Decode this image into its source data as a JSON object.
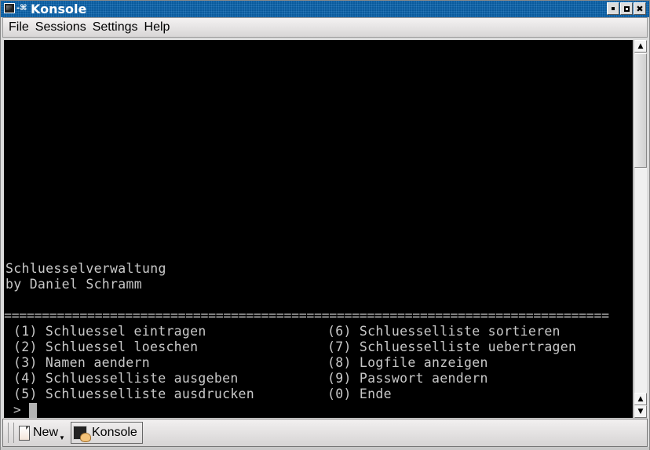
{
  "window": {
    "title": "Konsole",
    "controls": {
      "minimize": "minimize",
      "maximize": "maximize",
      "close": "✖"
    }
  },
  "menubar": {
    "items": [
      "File",
      "Sessions",
      "Settings",
      "Help"
    ]
  },
  "terminal": {
    "header_line1": "Schluesselverwaltung",
    "header_line2": "by Daniel Schramm",
    "separator": "================================================================================",
    "menu_left": [
      "(1) Schluessel eintragen",
      "(2) Schluessel loeschen",
      "(3) Namen aendern",
      "(4) Schluesselliste ausgeben",
      "(5) Schluesselliste ausdrucken"
    ],
    "menu_right": [
      "(6) Schluesselliste sortieren",
      "(7) Schluesselliste uebertragen",
      "(8) Logfile anzeigen",
      "(9) Passwort aendern",
      "(0) Ende"
    ],
    "prompt": ">"
  },
  "taskbar": {
    "new_label": "New",
    "session_label": "Konsole"
  }
}
